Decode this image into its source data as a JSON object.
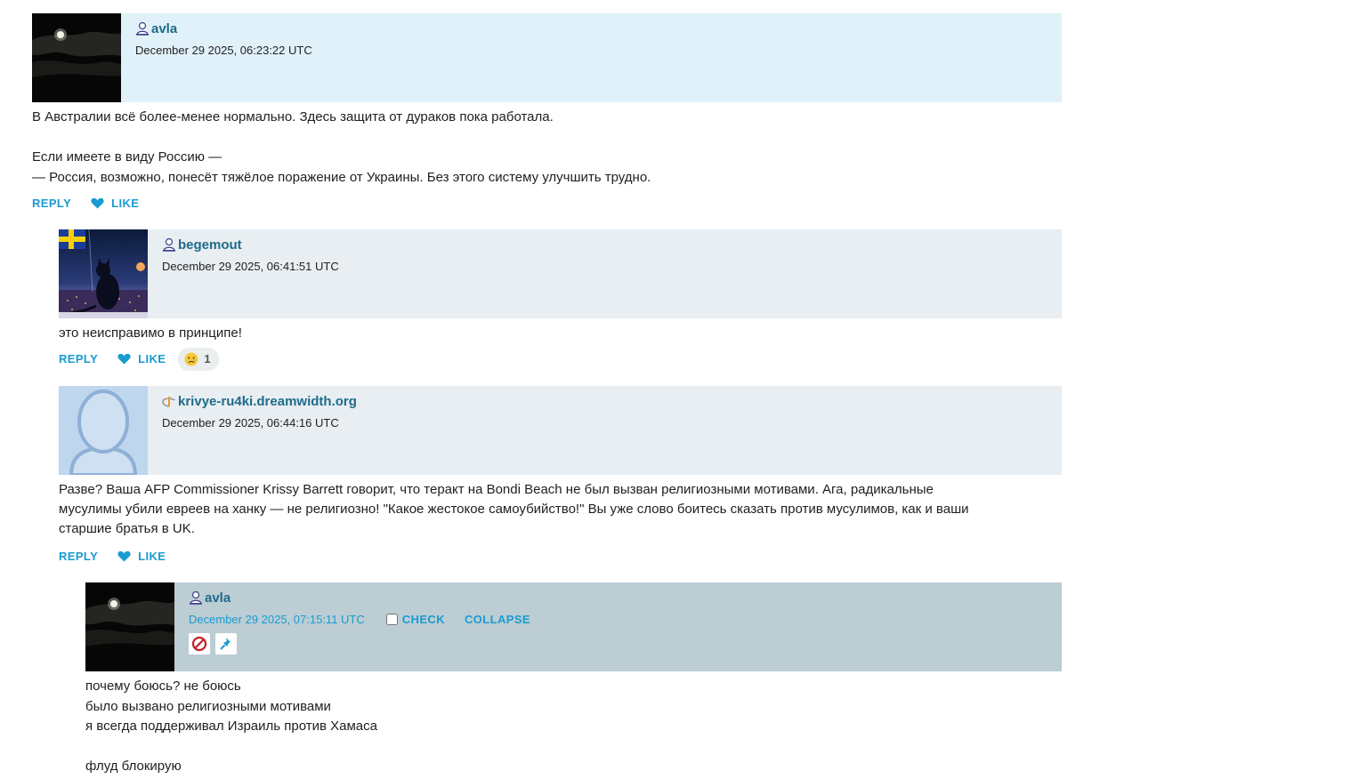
{
  "labels": {
    "reply": "REPLY",
    "like": "LIKE",
    "check": "CHECK",
    "collapse": "COLLAPSE"
  },
  "colors": {
    "accent": "#1a9bd0",
    "username": "#1f6b8a",
    "head_level1": "#e1f1f9",
    "head_level2": "#e8eef1",
    "head_selected": "#bccdd4"
  },
  "comments": [
    {
      "user": "avla",
      "user_icon": "personal-journal-icon",
      "date": "December 29 2025, 06:23:22 UTC",
      "lines": [
        "В Австралии всё более-менее нормально. Здесь защита от дураков пока работала.",
        "",
        "Если имеете в виду Россию —",
        "— Россия, возможно, понесёт тяжёлое поражение от Украины. Без этого систему улучшить трудно."
      ]
    },
    {
      "user": "begemout",
      "user_icon": "personal-journal-icon",
      "date": "December 29 2025, 06:41:51 UTC",
      "lines": [
        "это неисправимо в принципе!"
      ],
      "reaction": {
        "icon": "sad-face-icon",
        "count": "1"
      }
    },
    {
      "user": "krivye-ru4ki.dreamwidth.org",
      "user_icon": "openid-icon",
      "date": "December 29 2025, 06:44:16 UTC",
      "lines": [
        "Разве? Ваша AFP Commissioner Krissy Barrett говорит, что теракт на Bondi Beach не был вызван религиозными мотивами. Ага, радикальные",
        "мусулимы убили евреев на ханку — не религиозно! \"Какое жестокое самоубийство!\" Вы уже слово боитесь сказать против мусулимов, как и ваши",
        "старшие братья в UK."
      ]
    },
    {
      "user": "avla",
      "user_icon": "personal-journal-icon",
      "date": "December 29 2025, 07:15:11 UTC",
      "lines": [
        "почему боюсь? не боюсь",
        "было вызвано религиозными мотивами",
        "я всегда поддерживал Израиль против Хамаса",
        "",
        "флуд блокирую"
      ],
      "tools": [
        "ban-icon",
        "pin-icon"
      ]
    }
  ]
}
